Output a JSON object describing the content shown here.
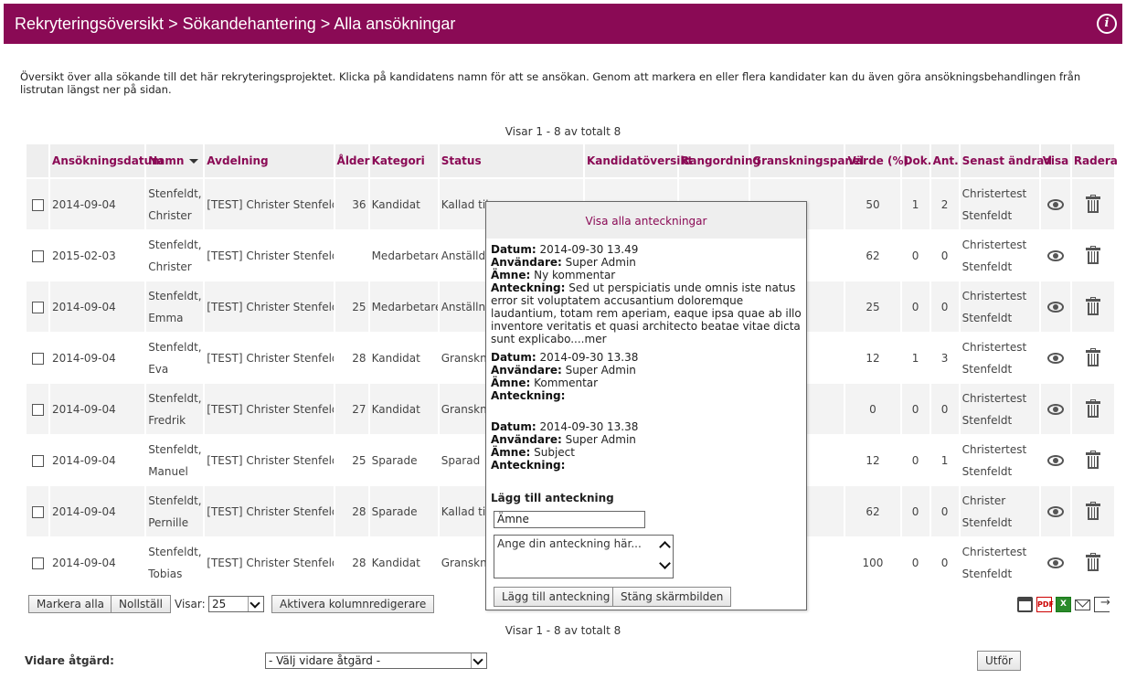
{
  "header": {
    "breadcrumb": [
      "Rekryteringsöversikt",
      "Sökandehantering",
      "Alla ansökningar"
    ],
    "separator": ">",
    "info_icon_glyph": "i",
    "background_color": "#8a0a55"
  },
  "intro": "Översikt över alla sökande till det här rekryteringsprojektet. Klicka på kandidatens namn för att se ansökan. Genom att markera en eller flera kandidater kan du även göra ansökningsbehandlingen från listrutan längst ner på sidan.",
  "showing_text": "Visar 1 - 8 av totalt 8",
  "table": {
    "columns": [
      "Ansökningsdatum",
      "Namn",
      "Avdelning",
      "Ålder",
      "Kategori",
      "Status",
      "Kandidatöversikt",
      "Rangordning",
      "Granskningspanel",
      "Värde (%)",
      "Dok.",
      "Ant.",
      "Senast ändrad",
      "Visa",
      "Radera"
    ],
    "rows": [
      {
        "date": "2014-09-04",
        "name_last": "Stenfeldt,",
        "name_first": "Christer",
        "dept": "[TEST] Christer Stenfeldt",
        "age": "36",
        "category": "Kandidat",
        "status": "Kallad til",
        "value": "50",
        "docs": "1",
        "notes": "2",
        "modified_1": "Christertest",
        "modified_2": "Stenfeldt"
      },
      {
        "date": "2015-02-03",
        "name_last": "Stenfeldt,",
        "name_first": "Christer",
        "dept": "[TEST] Christer Stenfeldt",
        "age": "",
        "category": "Medarbetare",
        "status": "Anställd",
        "value": "62",
        "docs": "0",
        "notes": "0",
        "modified_1": "Christertest",
        "modified_2": "Stenfeldt"
      },
      {
        "date": "2014-09-04",
        "name_last": "Stenfeldt,",
        "name_first": "Emma",
        "dept": "[TEST] Christer Stenfeldt",
        "age": "25",
        "category": "Medarbetare",
        "status": "Anställni",
        "value": "25",
        "docs": "0",
        "notes": "0",
        "modified_1": "Christertest",
        "modified_2": "Stenfeldt"
      },
      {
        "date": "2014-09-04",
        "name_last": "Stenfeldt,",
        "name_first": "Eva",
        "dept": "[TEST] Christer Stenfeldt",
        "age": "28",
        "category": "Kandidat",
        "status": "Granskni",
        "value": "12",
        "docs": "1",
        "notes": "3",
        "modified_1": "Christertest",
        "modified_2": "Stenfeldt"
      },
      {
        "date": "2014-09-04",
        "name_last": "Stenfeldt,",
        "name_first": "Fredrik",
        "dept": "[TEST] Christer Stenfeldt",
        "age": "27",
        "category": "Kandidat",
        "status": "Granskni",
        "value": "0",
        "docs": "0",
        "notes": "0",
        "modified_1": "Christertest",
        "modified_2": "Stenfeldt"
      },
      {
        "date": "2014-09-04",
        "name_last": "Stenfeldt,",
        "name_first": "Manuel",
        "dept": "[TEST] Christer Stenfeldt",
        "age": "25",
        "category": "Sparade",
        "status": "Sparad",
        "value": "12",
        "docs": "0",
        "notes": "1",
        "modified_1": "Christertest",
        "modified_2": "Stenfeldt"
      },
      {
        "date": "2014-09-04",
        "name_last": "Stenfeldt,",
        "name_first": "Pernille",
        "dept": "[TEST] Christer Stenfeldt",
        "age": "28",
        "category": "Sparade",
        "status": "Kallad til",
        "value": "62",
        "docs": "0",
        "notes": "0",
        "modified_1": "Christer",
        "modified_2": "Stenfeldt"
      },
      {
        "date": "2014-09-04",
        "name_last": "Stenfeldt,",
        "name_first": "Tobias",
        "dept": "[TEST] Christer Stenfeldt",
        "age": "28",
        "category": "Kandidat",
        "status": "Granskni",
        "value": "100",
        "docs": "0",
        "notes": "0",
        "modified_1": "Christertest",
        "modified_2": "Stenfeldt"
      }
    ]
  },
  "controls": {
    "select_all": "Markera alla",
    "reset": "Nollställ",
    "showing_label": "Visar:",
    "page_size": "25",
    "column_editor": "Aktivera kolumnredigerare"
  },
  "export_icons": [
    "print-icon",
    "pdf-icon",
    "excel-icon",
    "mail-icon",
    "export-icon"
  ],
  "export_glyphs": {
    "pdf": "PDF",
    "xls": "X"
  },
  "further_action": {
    "label": "Vidare åtgärd:",
    "placeholder": "- Välj vidare åtgärd -",
    "execute": "Utför"
  },
  "popup": {
    "title": "Visa alla anteckningar",
    "labels": {
      "date": "Datum:",
      "user": "Användare:",
      "subject": "Ämne:",
      "note": "Anteckning:"
    },
    "notes": [
      {
        "date": "2014-09-30 13.49",
        "user": "Super Admin",
        "subject": "Ny kommentar",
        "note": "Sed ut perspiciatis unde omnis iste natus error sit voluptatem accusantium doloremque laudantium, totam rem aperiam, eaque ipsa quae ab illo inventore veritatis et quasi architecto beatae vitae dicta sunt explicabo....mer"
      },
      {
        "date": "2014-09-30 13.38",
        "user": "Super Admin",
        "subject": "Kommentar",
        "note": ""
      },
      {
        "date": "2014-09-30 13.38",
        "user": "Super Admin",
        "subject": "Subject",
        "note": ""
      }
    ],
    "add_heading": "Lägg till anteckning",
    "subject_value": "Ämne",
    "note_placeholder": "Ange din anteckning här...",
    "add_button": "Lägg till anteckning",
    "close_button": "Stäng skärmbilden"
  }
}
